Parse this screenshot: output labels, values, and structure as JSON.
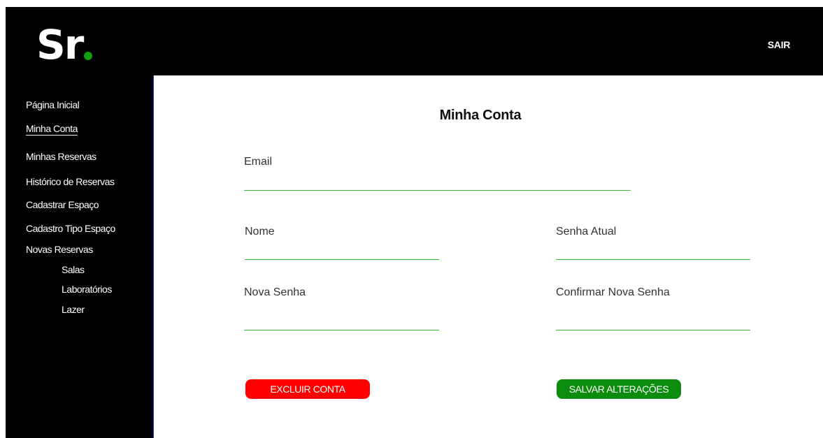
{
  "header": {
    "logo_text": "Sr",
    "logout_label": "SAIR"
  },
  "sidebar": {
    "items": [
      {
        "label": "Página Inicial",
        "active": false
      },
      {
        "label": "Minha Conta",
        "active": true
      },
      {
        "label": "Minhas Reservas",
        "active": false
      },
      {
        "label": "Histórico de Reservas",
        "active": false
      },
      {
        "label": "Cadastrar Espaço",
        "active": false
      },
      {
        "label": "Cadastro Tipo Espaço",
        "active": false
      },
      {
        "label": "Novas Reservas",
        "active": false
      }
    ],
    "subitems": [
      {
        "label": "Salas"
      },
      {
        "label": "Laboratórios"
      },
      {
        "label": "Lazer"
      }
    ]
  },
  "main": {
    "title": "Minha Conta",
    "fields": {
      "email": {
        "label": "Email",
        "value": ""
      },
      "name": {
        "label": "Nome",
        "value": ""
      },
      "current_password": {
        "label": "Senha Atual",
        "value": ""
      },
      "new_password": {
        "label": "Nova Senha",
        "value": ""
      },
      "confirm_password": {
        "label": "Confirmar Nova Senha",
        "value": ""
      }
    },
    "delete_label": "EXCLUIR CONTA",
    "save_label": "SALVAR ALTERAÇÕES"
  },
  "colors": {
    "brand_green": "#10a010",
    "input_underline": "#3bb53b",
    "delete_button": "#ff0000",
    "save_button": "#0c8c0c",
    "chrome": "#000000"
  }
}
